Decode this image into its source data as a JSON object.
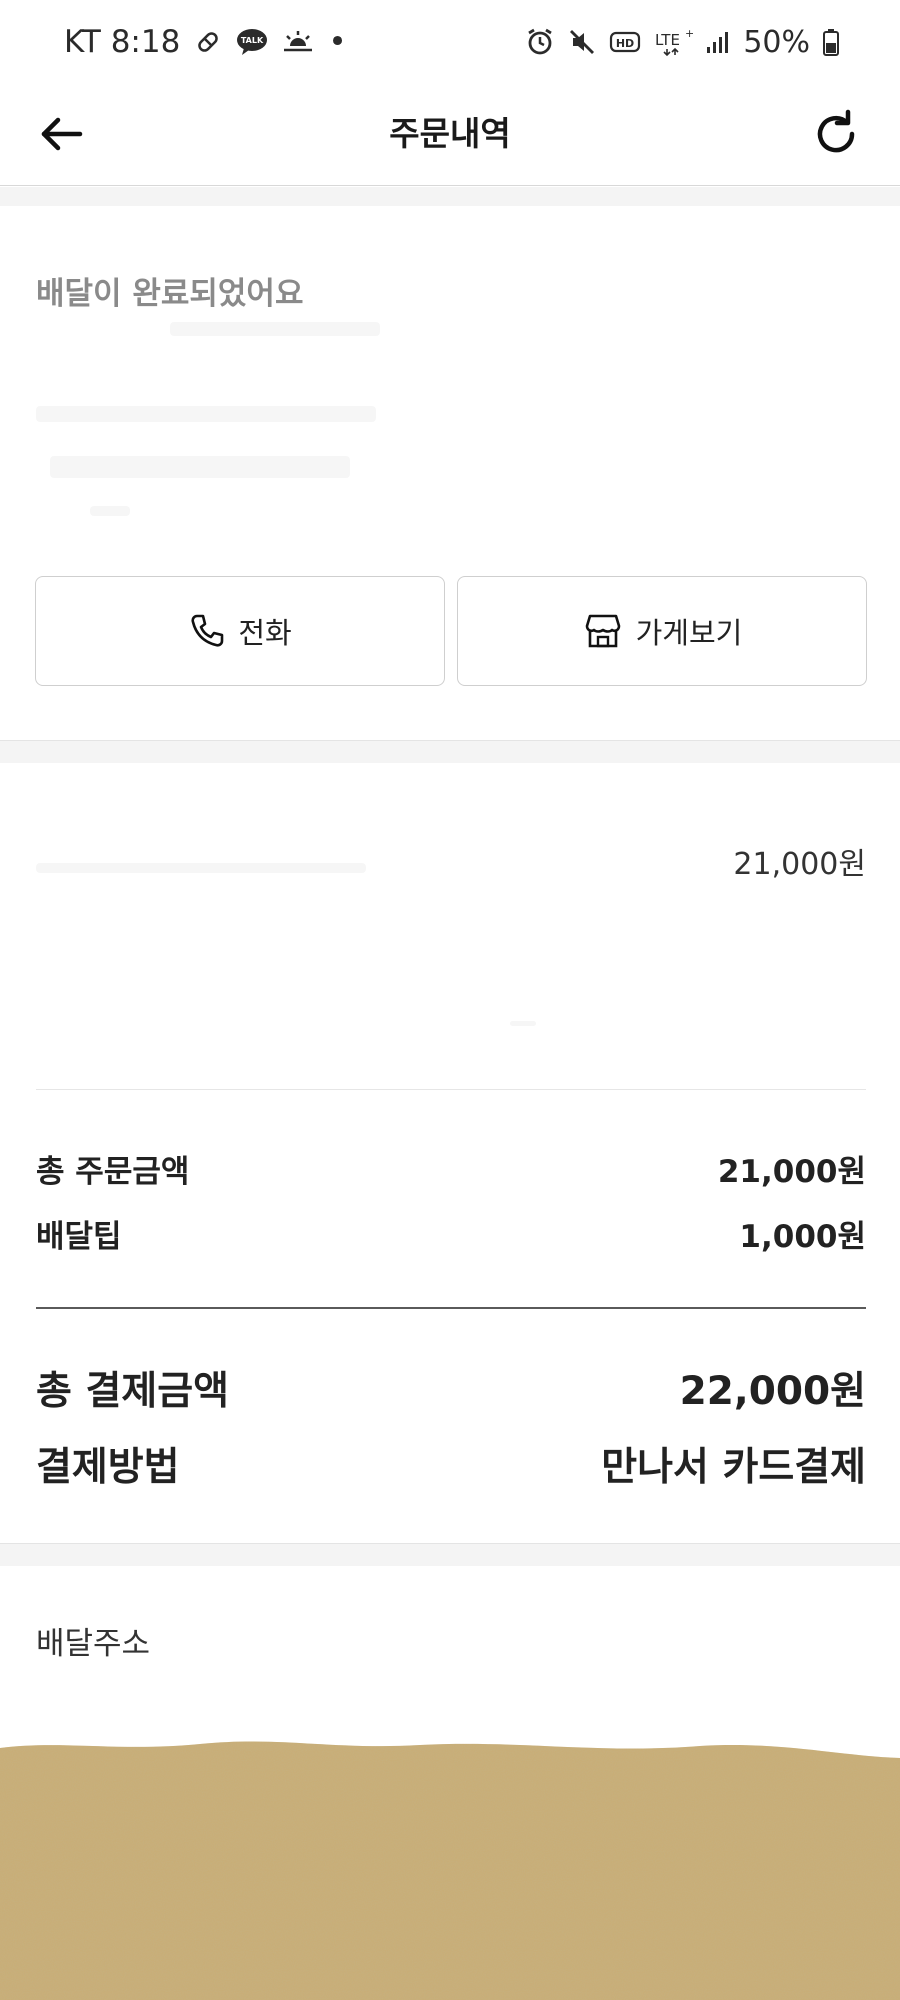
{
  "status_bar": {
    "carrier_time": "KT 8:18",
    "dot": "•",
    "battery": "50%"
  },
  "header": {
    "title": "주문내역"
  },
  "status": {
    "message": "배달이 완료되었어요"
  },
  "actions": {
    "call_label": "전화",
    "store_label": "가게보기"
  },
  "order": {
    "item_price": "21,000원",
    "order_total_label": "총 주문금액",
    "order_total_value": "21,000원",
    "delivery_tip_label": "배달팁",
    "delivery_tip_value": "1,000원",
    "payment_total_label": "총 결제금액",
    "payment_total_value": "22,000원",
    "payment_method_label": "결제방법",
    "payment_method_value": "만나서 카드결제"
  },
  "address": {
    "label": "배달주소"
  },
  "colors": {
    "text_primary": "#1a1a1a",
    "text_muted": "#8a8a8a",
    "section_gap": "#f4f4f4",
    "sand": "#c9ad74"
  }
}
